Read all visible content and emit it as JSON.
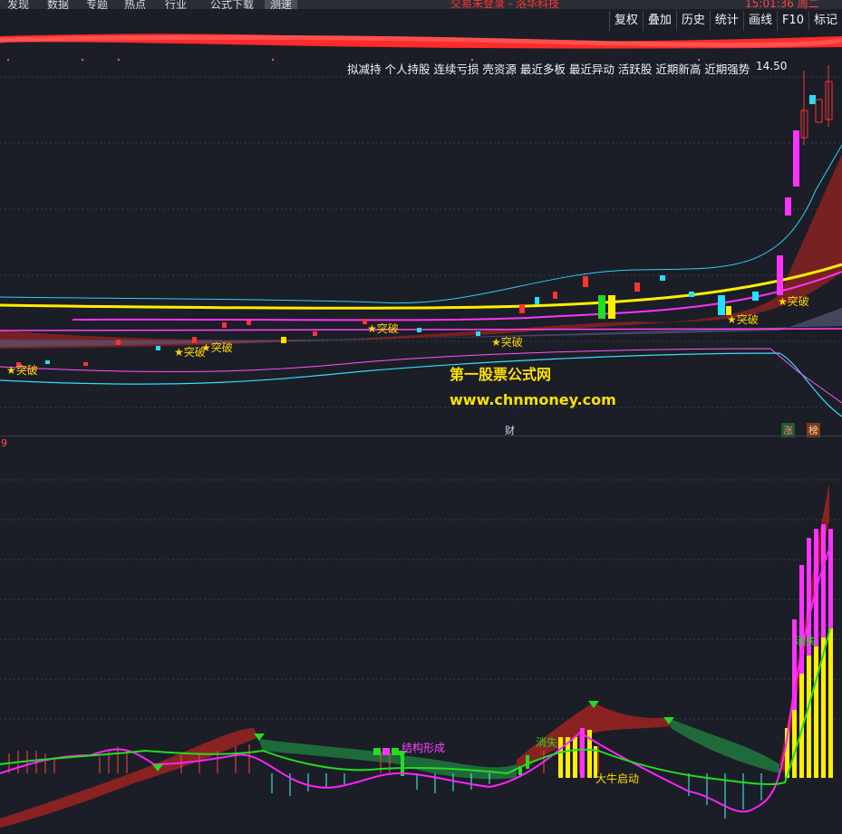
{
  "topbar": {
    "tabs": [
      "发现",
      "数据",
      "专题",
      "热点",
      "行业",
      "公式下载",
      "测速"
    ],
    "title": "交易未登录 - 洛华科技",
    "clock": "15:01:36 周二"
  },
  "toolbar": [
    "复权",
    "叠加",
    "历史",
    "统计",
    "画线",
    "F10",
    "标记"
  ],
  "stock_list": "拟减持 个人持股 连续亏损 壳资源 最近多板 最近异动 活跃股 近期新高 近期强势",
  "price_label": "14.50",
  "breakout_label": "★突破",
  "watermark": {
    "line1": "第一股票公式网",
    "line2": "www.chnmoney.com"
  },
  "markers": {
    "cai": "财",
    "zhang": "涨",
    "bang": "榜"
  },
  "indicator": {
    "period_label": "9",
    "jiegou": "结构形成",
    "xiaoshi1": "消失",
    "xiaoshi2": "消失",
    "daniu": "大牛启动"
  },
  "colors": {
    "bg": "#1b1e26",
    "yellow": "#ffd400",
    "magenta": "#ff22ff",
    "cyan": "#22e0ff",
    "green": "#22dd22",
    "red": "#cc3333"
  }
}
